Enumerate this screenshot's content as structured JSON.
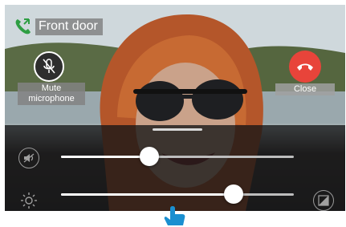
{
  "caller": {
    "name": "Front door"
  },
  "controls": {
    "mute_label": "Mute\nmicrophone",
    "close_label": "Close"
  },
  "sliders": {
    "volume": {
      "value_fraction": 0.38
    },
    "brightness": {
      "value_fraction": 0.74
    }
  },
  "icons": {
    "incoming_call": "phone-incoming-icon",
    "mute": "microphone-muted-icon",
    "close": "hang-up-icon",
    "volume": "speaker-muted-icon",
    "brightness": "sun-icon",
    "contrast": "contrast-icon",
    "gesture": "tap-hand-icon"
  },
  "colors": {
    "close_button": "#e8443a",
    "call_icon": "#2e9e43",
    "gesture_hand": "#1a8fd0"
  }
}
